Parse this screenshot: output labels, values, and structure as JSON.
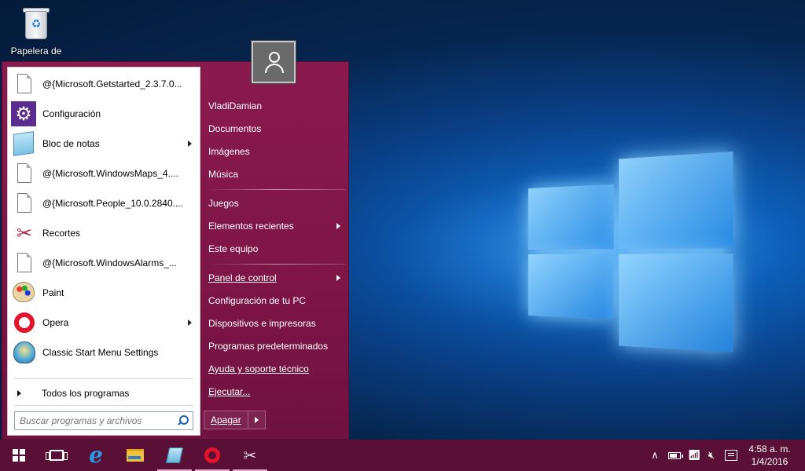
{
  "desktop": {
    "icons": [
      {
        "label": "Papelera de",
        "icon": "recycle-bin-icon"
      }
    ]
  },
  "start_menu": {
    "programs": [
      {
        "label": "@{Microsoft.Getstarted_2.3.7.0...",
        "icon": "document-icon",
        "submenu": false
      },
      {
        "label": "Configuración",
        "icon": "gear-icon",
        "submenu": false
      },
      {
        "label": "Bloc de notas",
        "icon": "notepad-icon",
        "submenu": true
      },
      {
        "label": "@{Microsoft.WindowsMaps_4....",
        "icon": "document-icon",
        "submenu": false
      },
      {
        "label": "@{Microsoft.People_10.0.2840....",
        "icon": "document-icon",
        "submenu": false
      },
      {
        "label": "Recortes",
        "icon": "scissors-icon",
        "submenu": false
      },
      {
        "label": "@{Microsoft.WindowsAlarms_...",
        "icon": "document-icon",
        "submenu": false
      },
      {
        "label": "Paint",
        "icon": "paint-palette-icon",
        "submenu": false
      },
      {
        "label": "Opera",
        "icon": "opera-icon",
        "submenu": true
      },
      {
        "label": "Classic Start Menu Settings",
        "icon": "shell-icon",
        "submenu": false
      }
    ],
    "all_programs": "Todos los programas",
    "search": {
      "placeholder": "Buscar programas y archivos",
      "value": ""
    },
    "right_items": {
      "user": "VladiDamian",
      "documents": "Documentos",
      "images": "Imágenes",
      "music": "Música",
      "games": "Juegos",
      "recent": "Elementos recientes",
      "this_pc": "Este equipo",
      "control_panel": "Panel de control",
      "pc_settings": "Configuración de tu PC",
      "devices": "Dispositivos e impresoras",
      "default_programs": "Programas predeterminados",
      "help": "Ayuda y soporte técnico",
      "run": "Ejecutar..."
    },
    "shutdown_label": "Apagar",
    "accent": "#7d1546"
  },
  "taskbar": {
    "color": "#5a0f36",
    "buttons": [
      {
        "name": "start",
        "icon": "windows-icon"
      },
      {
        "name": "task-view",
        "icon": "task-view-icon"
      },
      {
        "name": "internet-explorer",
        "icon": "ie-icon"
      },
      {
        "name": "file-explorer",
        "icon": "folder-icon"
      },
      {
        "name": "notepad",
        "icon": "notepad-icon"
      },
      {
        "name": "opera",
        "icon": "opera-icon"
      },
      {
        "name": "snipping-tool",
        "icon": "scissors-icon"
      }
    ],
    "ie_glyph": "e",
    "snip_glyph": "✂",
    "tray": {
      "chevron_glyph": "∧",
      "mute_glyph": "🔇︎",
      "wifi_glyph": "📶︎"
    },
    "clock": {
      "time": "4:58 a. m.",
      "date": "1/4/2016"
    }
  }
}
